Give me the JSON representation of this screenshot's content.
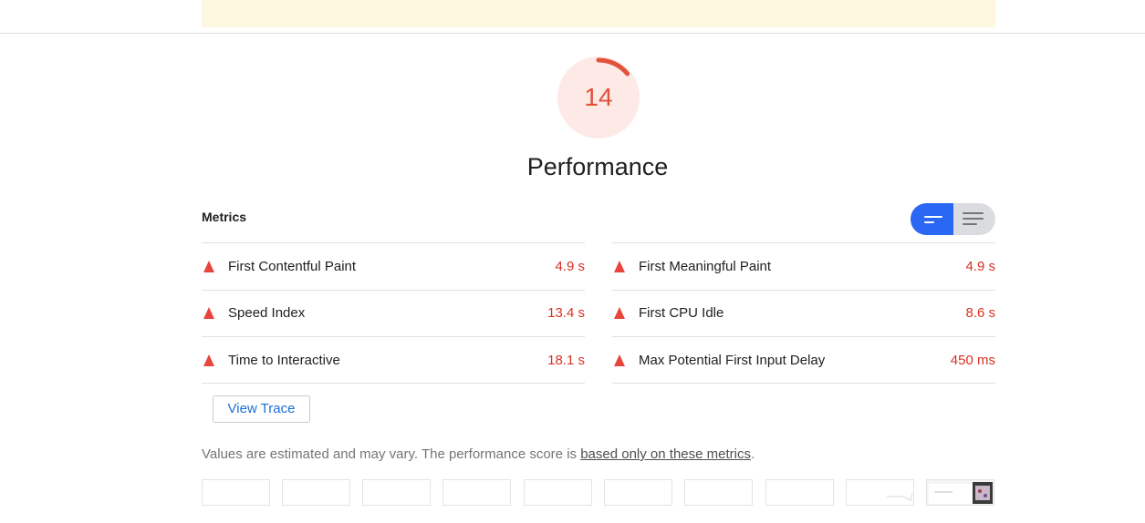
{
  "gauge": {
    "score": "14",
    "title": "Performance",
    "color": "#e2513c",
    "fraction": 0.14
  },
  "metrics": {
    "header": "Metrics",
    "toggle": {
      "active": "left"
    },
    "left": [
      {
        "icon": "fail-triangle-icon",
        "label": "First Contentful Paint",
        "value": "4.9 s"
      },
      {
        "icon": "fail-triangle-icon",
        "label": "Speed Index",
        "value": "13.4 s"
      },
      {
        "icon": "fail-triangle-icon",
        "label": "Time to Interactive",
        "value": "18.1 s"
      }
    ],
    "right": [
      {
        "icon": "fail-triangle-icon",
        "label": "First Meaningful Paint",
        "value": "4.9 s"
      },
      {
        "icon": "fail-triangle-icon",
        "label": "First CPU Idle",
        "value": "8.6 s"
      },
      {
        "icon": "fail-triangle-icon",
        "label": "Max Potential First Input Delay",
        "value": "450 ms"
      }
    ],
    "fail_color": "#e8453c"
  },
  "view_trace_label": "View Trace",
  "note": {
    "text": "Values are estimated and may vary. The performance score is ",
    "link": "based only on these metrics",
    "end": "."
  },
  "filmstrip": {
    "frame_count": 10
  }
}
